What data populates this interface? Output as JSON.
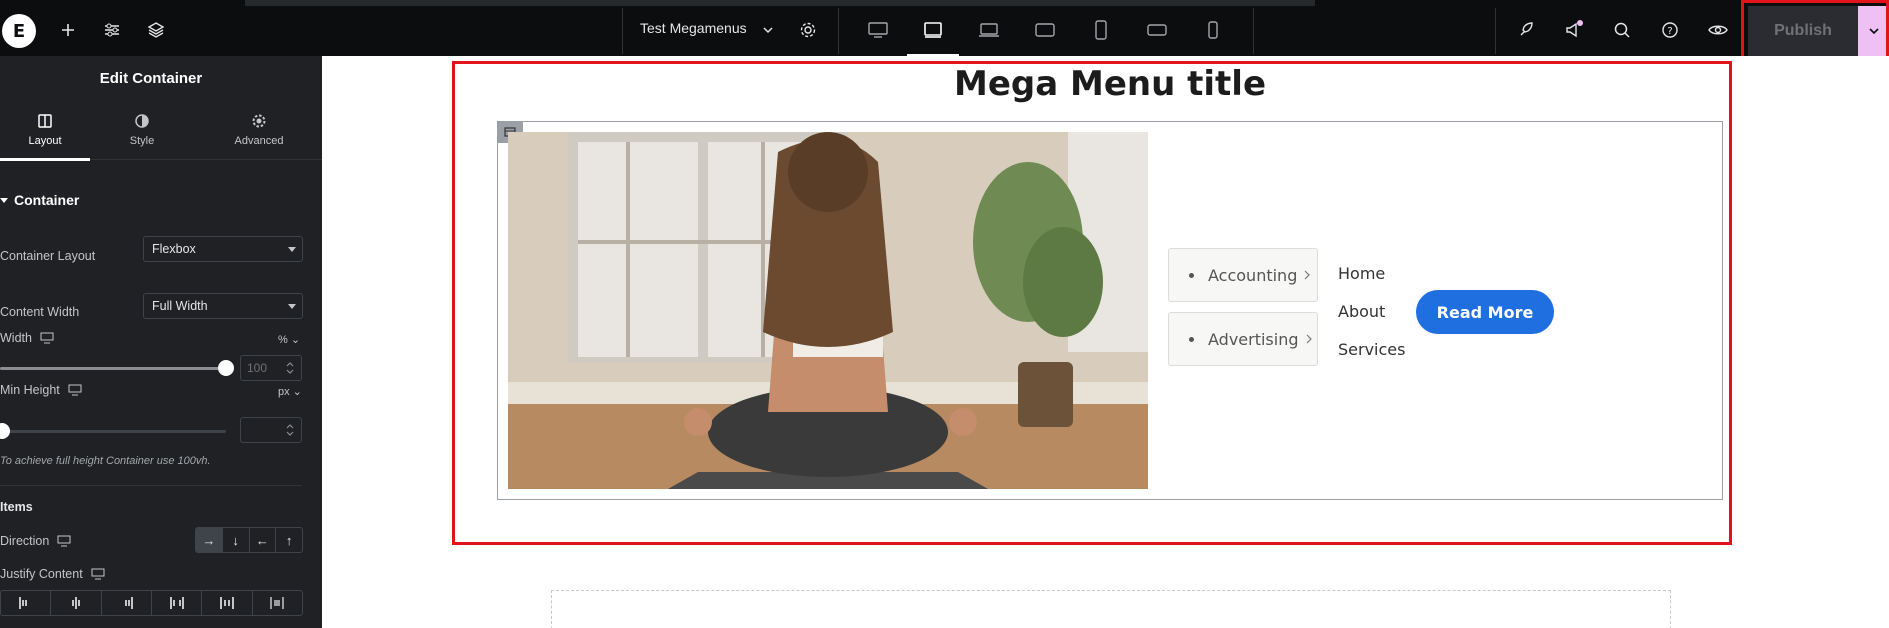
{
  "topbar": {
    "document_title": "Test Megamenus",
    "publish_label": "Publish",
    "icons": [
      "elementor-logo-icon",
      "add-icon",
      "site-settings-icon",
      "structure-icon",
      "page-settings-icon",
      "desktop-icon",
      "tablet-icon",
      "laptop-icon",
      "tablet-landscape-icon",
      "mobile-icon",
      "mobile-landscape-icon",
      "mobile-small-icon",
      "rocket-icon",
      "megaphone-icon",
      "search-icon",
      "help-icon",
      "preview-icon"
    ],
    "active_device": "tablet"
  },
  "panel": {
    "title": "Edit Container",
    "tabs": [
      {
        "label": "Layout",
        "icon": "layout-icon"
      },
      {
        "label": "Style",
        "icon": "style-icon"
      },
      {
        "label": "Advanced",
        "icon": "advanced-gear-icon"
      }
    ],
    "section": "Container",
    "container_layout": {
      "label": "Container Layout",
      "value": "Flexbox"
    },
    "content_width": {
      "label": "Content Width",
      "value": "Full Width"
    },
    "width": {
      "label": "Width",
      "unit": "%",
      "value": "100"
    },
    "min_height": {
      "label": "Min Height",
      "unit": "px",
      "value": ""
    },
    "hint": "To achieve full height Container use 100vh.",
    "items_label": "Items",
    "direction_label": "Direction",
    "direction_options": [
      "→",
      "↓",
      "←",
      "↑"
    ],
    "justify_label": "Justify Content"
  },
  "canvas": {
    "mega_menu_title": "Mega Menu title",
    "menu_items": [
      "Accounting",
      "Advertising"
    ],
    "nav_links": [
      "Home",
      "About",
      "Services"
    ],
    "button_label": "Read More"
  },
  "colors": {
    "accent_red": "#e2131b",
    "button_blue": "#1f6fe0",
    "publish_caret": "#eec0f3"
  }
}
